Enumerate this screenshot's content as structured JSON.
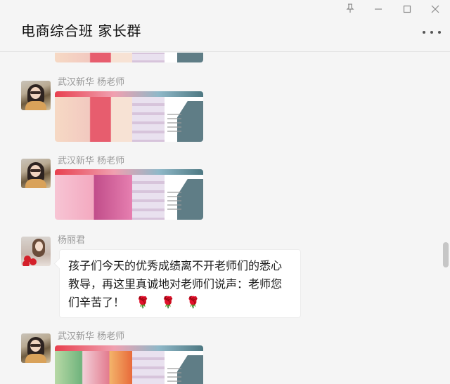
{
  "window": {
    "title": "电商综合班 家长群",
    "pin_icon": "pin-icon",
    "minimize_icon": "minimize-icon",
    "maximize_icon": "maximize-icon",
    "close_icon": "close-icon",
    "more_icon": "more-options-icon"
  },
  "messages": [
    {
      "type": "image",
      "sender": "武汉新华 杨老师"
    },
    {
      "type": "image",
      "sender": "武汉新华 杨老师"
    },
    {
      "type": "text",
      "sender": "杨丽君",
      "text": "孩子们今天的优秀成绩离不开老师们的悉心教导，再这里真诚地对老师们说声：老师您们辛苦了！",
      "emoji": [
        "🌹",
        "🌹",
        "🌹"
      ]
    },
    {
      "type": "image",
      "sender": "武汉新华 杨老师"
    }
  ]
}
